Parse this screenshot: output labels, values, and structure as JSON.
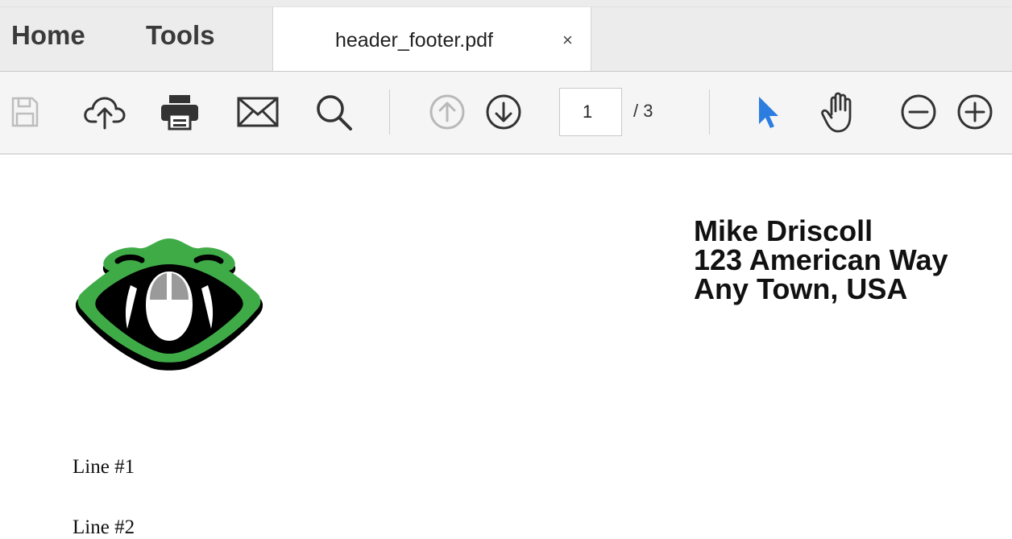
{
  "tabs": {
    "home_label": "Home",
    "tools_label": "Tools",
    "file_tab": {
      "name": "header_footer.pdf",
      "close": "×"
    }
  },
  "toolbar": {
    "icons": [
      "save-icon",
      "upload-icon",
      "print-icon",
      "email-icon",
      "search-icon",
      "page-up-icon",
      "page-down-icon",
      "select-arrow-icon",
      "hand-icon",
      "zoom-out-icon",
      "zoom-in-icon"
    ],
    "current_page": "1",
    "page_total": "/ 3",
    "accent_color": "#2b7de0"
  },
  "document": {
    "address": [
      "Mike Driscoll",
      "123 American Way",
      "Any Town, USA"
    ],
    "lines": [
      "Line #1",
      "Line #2"
    ],
    "logo_colors": {
      "green": "#3fab47",
      "black": "#000000"
    }
  }
}
